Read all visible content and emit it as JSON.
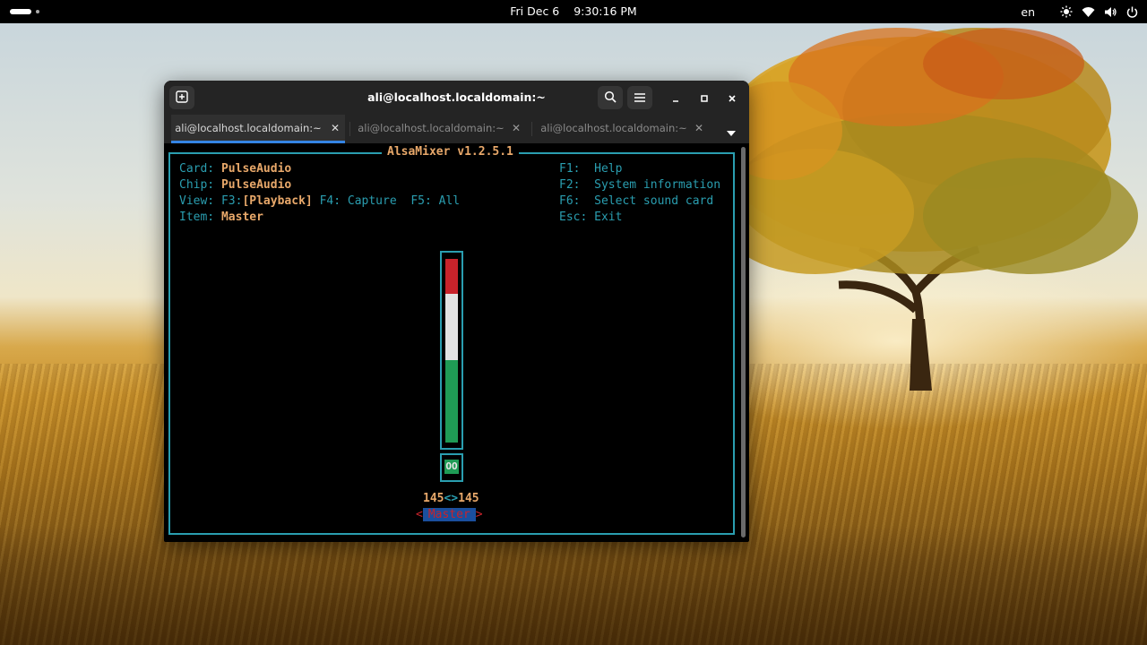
{
  "topbar": {
    "date": "Fri Dec 6",
    "time": "9:30:16 PM",
    "keyboard_layout": "en",
    "icons": [
      "activities-pill-icon",
      "workspace-dot-icon",
      "brightness-icon",
      "wifi-icon",
      "volume-icon",
      "power-icon"
    ]
  },
  "window": {
    "title": "ali@localhost.localdomain:~",
    "tabs": [
      {
        "label": "ali@localhost.localdomain:~",
        "active": true
      },
      {
        "label": "ali@localhost.localdomain:~",
        "active": false
      },
      {
        "label": "ali@localhost.localdomain:~",
        "active": false
      }
    ],
    "icons": [
      "new-tab-icon",
      "search-icon",
      "hamburger-menu-icon",
      "minimize-icon",
      "maximize-icon",
      "close-icon",
      "tab-close-icon",
      "tabs-dropdown-icon"
    ]
  },
  "alsamixer": {
    "title": "AlsaMixer v1.2.5.1",
    "card_label": "Card:",
    "card_value": "PulseAudio",
    "chip_label": "Chip:",
    "chip_value": "PulseAudio",
    "view_label": "View:",
    "view_f3": "F3:",
    "view_f3_value": "[Playback]",
    "view_f4": "F4:",
    "view_f4_value": "Capture",
    "view_f5": "F5:",
    "view_f5_value": "All",
    "item_label": "Item:",
    "item_value": "Master",
    "help": [
      {
        "key": "F1:",
        "action": "Help"
      },
      {
        "key": "F2:",
        "action": "System information"
      },
      {
        "key": "F6:",
        "action": "Select sound card"
      },
      {
        "key": "Esc:",
        "action": "Exit"
      }
    ],
    "meter": {
      "level_percent": 100,
      "red_fraction": 0.19,
      "white_fraction": 0.36,
      "green_fraction": 0.45
    },
    "mute_state": "OO",
    "volume_left": "145",
    "volume_separator": "<>",
    "volume_right": "145",
    "control_left_marker": "<",
    "control_name": "Master",
    "control_right_marker": ">"
  },
  "colors": {
    "terminal_border": "#2a9eb0",
    "value_text": "#e8a86a",
    "meter_red": "#c8232b",
    "meter_white": "#e2e2e2",
    "meter_green": "#1f9b55",
    "selected_control_bg": "#1a4f9e",
    "tab_active_underline": "#3584e4"
  }
}
